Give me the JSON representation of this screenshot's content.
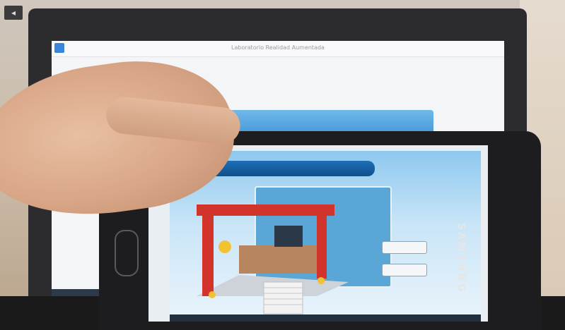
{
  "overlay": {
    "back_button": "◂"
  },
  "laptop": {
    "window_title": "Laboratorio Realidad Aumentada"
  },
  "phone": {
    "brand": "SAMSUNG"
  },
  "colors": {
    "app_blue": "#2f86cc",
    "crane_red": "#d2342c",
    "crane_yellow": "#f1c232"
  }
}
